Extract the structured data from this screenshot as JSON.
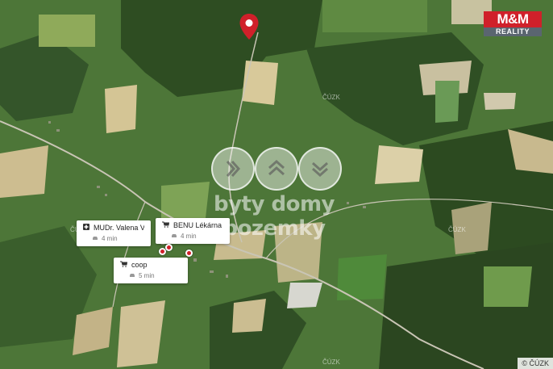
{
  "map": {
    "watermark_text": "byty domy pozemky",
    "cuzk_label": "ČÚZK",
    "copyright": "© ČÚZK"
  },
  "logo": {
    "top_text": "M&M",
    "bottom_text": "REALITY",
    "color": "#d0202a"
  },
  "pois": [
    {
      "name": "MUDr. Valena Vla...",
      "icon": "medical-cross-icon",
      "time": "4 min"
    },
    {
      "name": "BENU Lékárna",
      "icon": "cart-icon",
      "time": "4 min"
    },
    {
      "name": "coop",
      "icon": "cart-icon",
      "time": "5 min"
    }
  ],
  "colors": {
    "pin": "#d0202a",
    "accent": "#d0202a"
  }
}
